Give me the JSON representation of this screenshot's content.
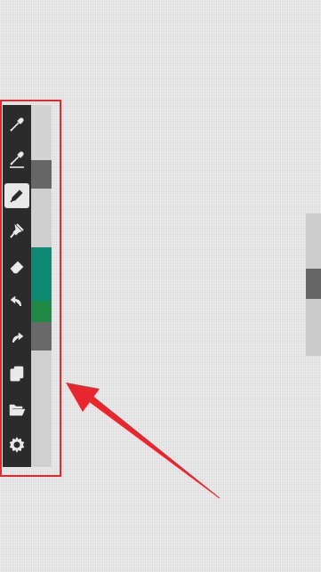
{
  "toolbar": {
    "tools": [
      {
        "name": "eyedropper",
        "icon": "eyedropper-icon",
        "active": false
      },
      {
        "name": "color-picker-edit",
        "icon": "eyedropper-edit-icon",
        "active": false
      },
      {
        "name": "pencil",
        "icon": "pencil-icon",
        "active": true
      },
      {
        "name": "fill",
        "icon": "pushpin-fill-icon",
        "active": false
      },
      {
        "name": "eraser",
        "icon": "eraser-icon",
        "active": false
      },
      {
        "name": "undo",
        "icon": "undo-icon",
        "active": false
      },
      {
        "name": "redo",
        "icon": "redo-icon",
        "active": false
      },
      {
        "name": "layers",
        "icon": "copy-layers-icon",
        "active": false
      },
      {
        "name": "open",
        "icon": "folder-open-icon",
        "active": false
      },
      {
        "name": "settings",
        "icon": "gear-icon",
        "active": false
      }
    ]
  },
  "palette": {
    "colors": [
      "#d3d3d3",
      "#666666",
      "#cfcfcf",
      "#0e8a73",
      "#1f8a46",
      "#6a6a6a",
      "#d0d0d0"
    ]
  },
  "annotation": {
    "highlight_color": "#e8262e",
    "arrow_color": "#e8262e"
  }
}
